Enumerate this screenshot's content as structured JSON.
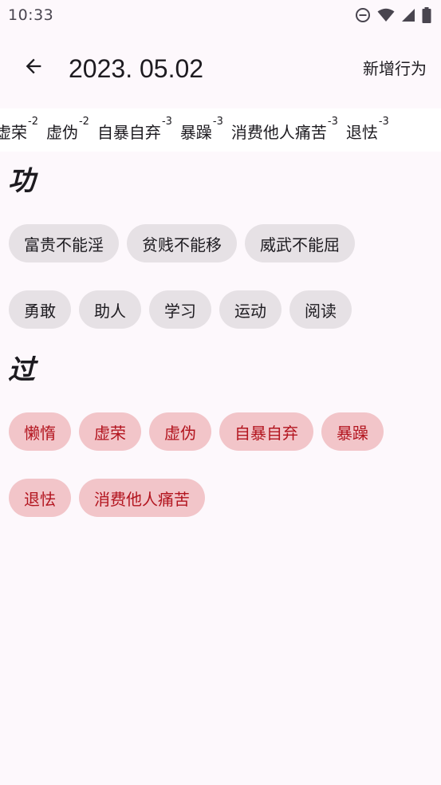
{
  "status_bar": {
    "time": "10:33",
    "icons": [
      "do-not-disturb-icon",
      "wifi-icon",
      "signal-icon",
      "battery-icon"
    ]
  },
  "app_bar": {
    "back_icon": "arrow-back-icon",
    "title": "2023. 05.02",
    "add_label": "新增行为"
  },
  "behavior_strip": [
    {
      "label": "虚荣",
      "score": "-2"
    },
    {
      "label": "虚伪",
      "score": "-2"
    },
    {
      "label": "自暴自弃",
      "score": "-3"
    },
    {
      "label": "暴躁",
      "score": "-3"
    },
    {
      "label": "消费他人痛苦",
      "score": "-3"
    },
    {
      "label": "退怯",
      "score": "-3"
    }
  ],
  "merit": {
    "heading": "功",
    "rows": [
      [
        "富贵不能淫",
        "贫贱不能移",
        "威武不能屈"
      ],
      [
        "勇敢",
        "助人",
        "学习",
        "运动",
        "阅读"
      ]
    ]
  },
  "demerit": {
    "heading": "过",
    "rows": [
      [
        "懒惰",
        "虚荣",
        "虚伪",
        "自暴自弃",
        "暴躁"
      ],
      [
        "退怯",
        "消费他人痛苦"
      ]
    ]
  },
  "colors": {
    "background": "#fdf8fc",
    "strip_background": "#ffffff",
    "merit_chip_bg": "#e6e1e5",
    "demerit_chip_bg": "#f2c5c9",
    "demerit_chip_text": "#b3151f"
  }
}
